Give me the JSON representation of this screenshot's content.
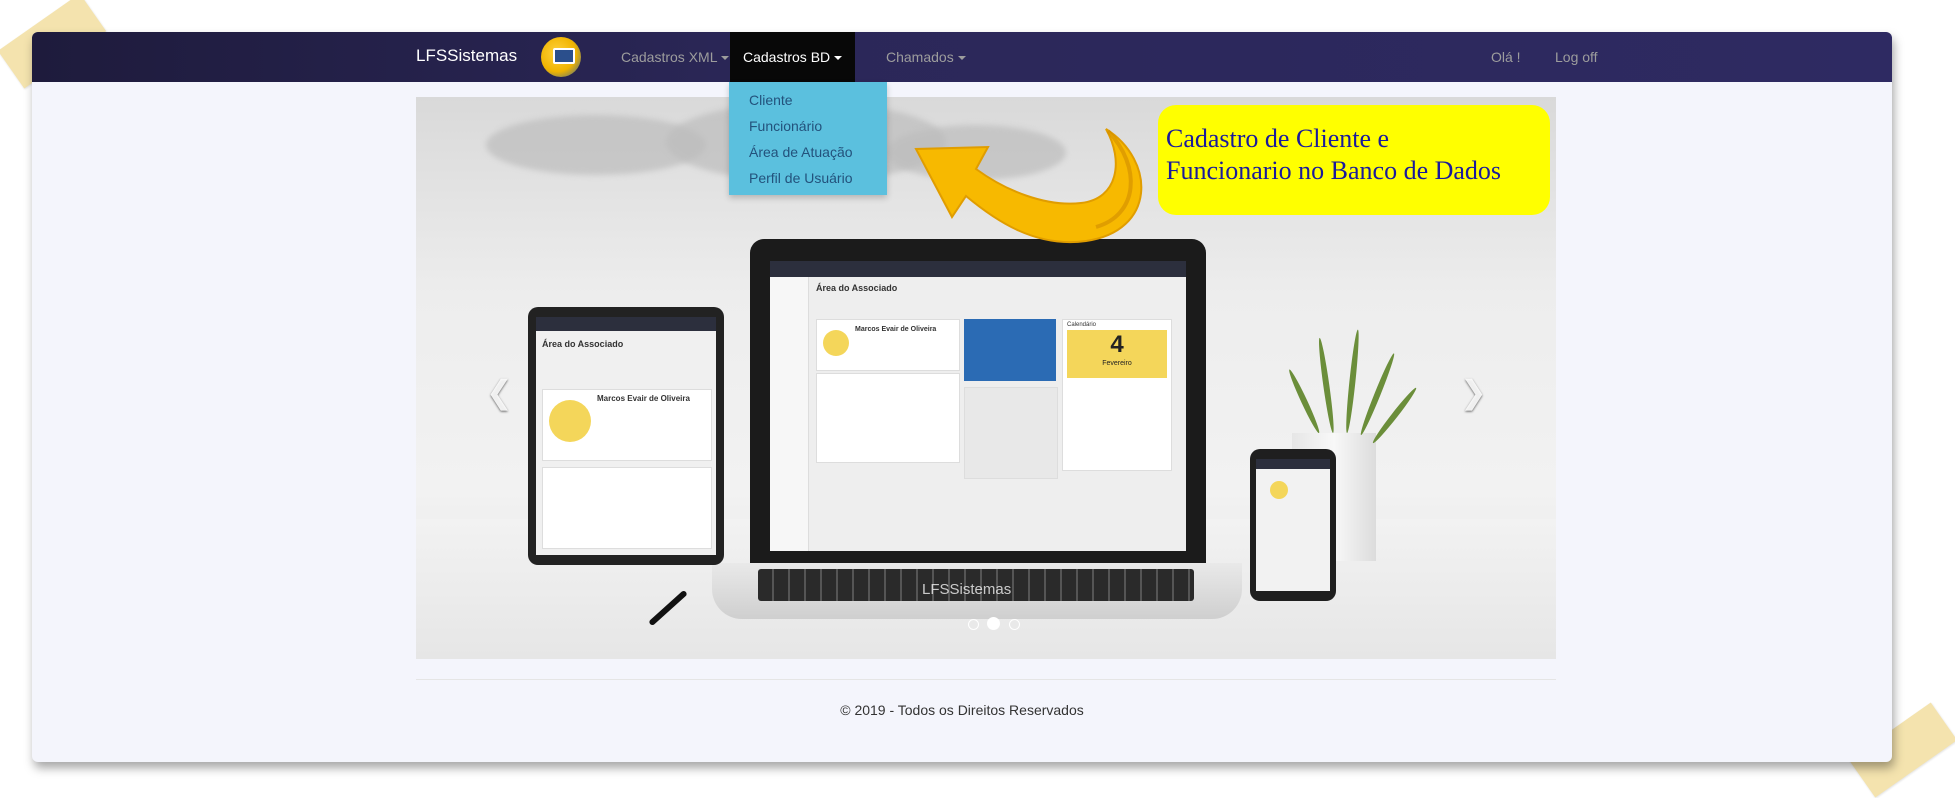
{
  "navbar": {
    "brand": "LFSSistemas",
    "logo_icon": "monitor-logo-icon",
    "menus": [
      {
        "label": "Cadastros XML",
        "active": false
      },
      {
        "label": "Cadastros BD",
        "active": true
      },
      {
        "label": "Chamados",
        "active": false
      }
    ],
    "greeting": "Olá !",
    "logoff": "Log off"
  },
  "dropdown": {
    "items": [
      "Cliente",
      "Funcionário",
      "Área de Atuação",
      "Perfil de Usuário"
    ]
  },
  "callout": {
    "line1": "Cadastro de Cliente e",
    "line2": "Funcionario no Banco de Dados",
    "background": "#ffff00",
    "text_color": "#1a1a9c"
  },
  "carousel": {
    "watermark": "LFSSistemas",
    "prev_icon": "chevron-left-icon",
    "next_icon": "chevron-right-icon",
    "mockup": {
      "page_title": "Área do Associado",
      "user_name": "Marcos Evair de Oliveira",
      "calendar_day": "4",
      "calendar_month": "Fevereiro",
      "calendar_label": "Calendário"
    }
  },
  "footer": {
    "text": "© 2019 - Todos os Direitos Reservados"
  },
  "colors": {
    "navbar_start": "#1e1b3c",
    "navbar_end": "#2e2a62",
    "dropdown_bg": "#5bc0de",
    "link": "#23527c"
  }
}
